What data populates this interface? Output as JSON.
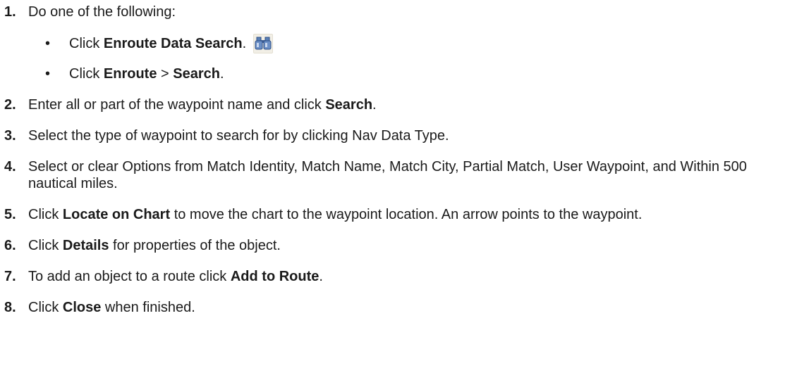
{
  "steps": [
    {
      "number": "1.",
      "text": "Do one of the following:"
    },
    {
      "number": "2.",
      "pre": "Enter all or part of the waypoint name and click ",
      "b1": "Search",
      "post": "."
    },
    {
      "number": "3.",
      "text": "Select the type of waypoint to search for by clicking Nav Data Type."
    },
    {
      "number": "4.",
      "text": "Select or clear Options from Match Identity, Match Name, Match City, Partial Match, User Waypoint, and Within 500 nautical miles."
    },
    {
      "number": "5.",
      "pre": "Click ",
      "b1": "Locate on Chart",
      "post": " to move the chart to the waypoint location. An arrow points to the waypoint."
    },
    {
      "number": "6.",
      "pre": "Click ",
      "b1": "Details",
      "post": " for properties of the object."
    },
    {
      "number": "7.",
      "pre": "To add an object to a route click ",
      "b1": "Add to Route",
      "post": "."
    },
    {
      "number": "8.",
      "pre": "Click ",
      "b1": "Close",
      "post": " when finished."
    }
  ],
  "substeps": [
    {
      "bullet": "•",
      "pre": "Click ",
      "b1": "Enroute Data Search",
      "post": ".",
      "icon": "binoculars-icon"
    },
    {
      "bullet": "•",
      "pre": "Click ",
      "b1": "Enroute",
      "mid": " > ",
      "b2": "Search",
      "post": "."
    }
  ]
}
